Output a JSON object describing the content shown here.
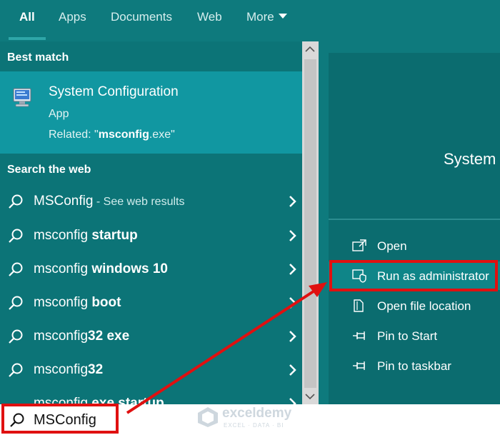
{
  "tabs": {
    "all": "All",
    "apps": "Apps",
    "documents": "Documents",
    "web": "Web",
    "more": "More"
  },
  "best_match": {
    "heading": "Best match",
    "title": "System Configuration",
    "type": "App",
    "related_prefix": "Related: \"",
    "related_bold": "msconfig",
    "related_suffix": ".exe\""
  },
  "search_web": {
    "heading": "Search the web",
    "items": [
      {
        "prefix": "MSConfig",
        "bold": "",
        "hint": " - See web results"
      },
      {
        "prefix": "msconfig ",
        "bold": "startup",
        "hint": ""
      },
      {
        "prefix": "msconfig ",
        "bold": "windows 10",
        "hint": ""
      },
      {
        "prefix": "msconfig ",
        "bold": "boot",
        "hint": ""
      },
      {
        "prefix": "msconfig",
        "bold": "32 exe",
        "hint": ""
      },
      {
        "prefix": "msconfig",
        "bold": "32",
        "hint": ""
      },
      {
        "prefix": "msconfig",
        "bold": " exe startup",
        "hint": ""
      }
    ]
  },
  "preview": {
    "title": "System",
    "actions": [
      {
        "label": "Open",
        "icon": "open-icon"
      },
      {
        "label": "Run as administrator",
        "icon": "shield-icon"
      },
      {
        "label": "Open file location",
        "icon": "file-location-icon"
      },
      {
        "label": "Pin to Start",
        "icon": "pin-icon"
      },
      {
        "label": "Pin to taskbar",
        "icon": "pin-icon"
      }
    ]
  },
  "search": {
    "value": "MSConfig"
  },
  "watermark": {
    "name": "exceldemy",
    "tagline": "EXCEL · DATA · BI"
  },
  "colors": {
    "background": "#0e7a7d",
    "best_match_bg": "#1197a1",
    "highlight_bg": "#0f8588",
    "annotation_red": "#e01010"
  }
}
